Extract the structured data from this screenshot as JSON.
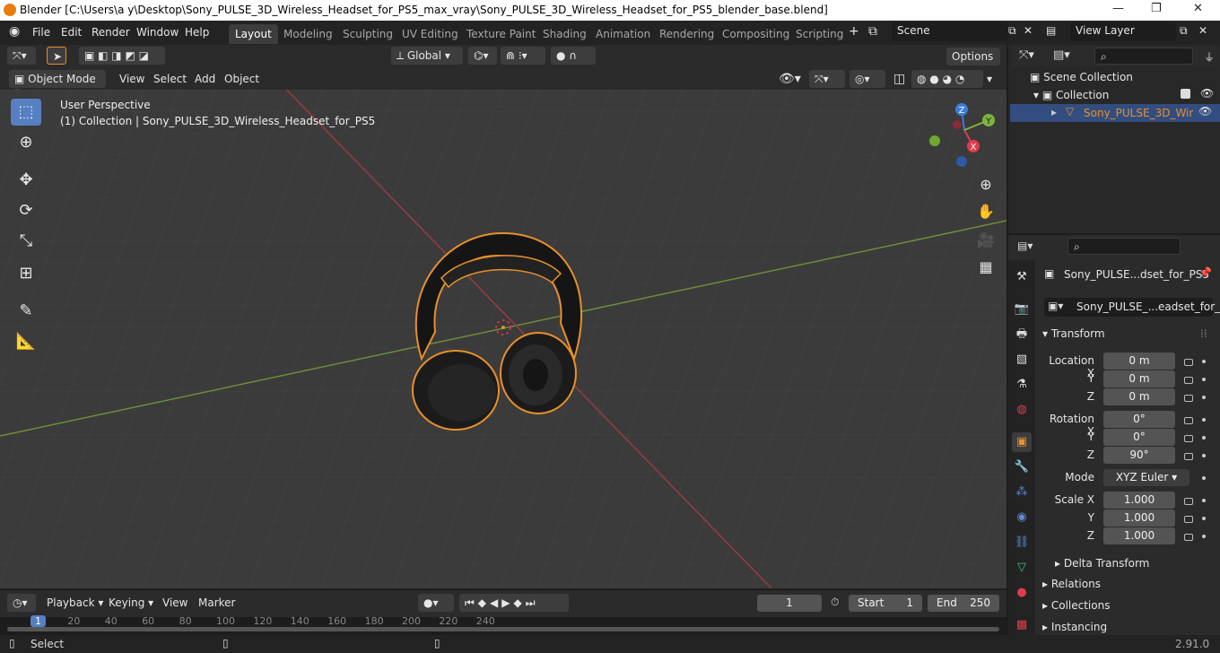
{
  "window": {
    "title": "Blender [C:\\Users\\a y\\Desktop\\Sony_PULSE_3D_Wireless_Headset_for_PS5_max_vray\\Sony_PULSE_3D_Wireless_Headset_for_PS5_blender_base.blend]"
  },
  "menus": [
    "File",
    "Edit",
    "Render",
    "Window",
    "Help"
  ],
  "workspaces": [
    "Layout",
    "Modeling",
    "Sculpting",
    "UV Editing",
    "Texture Paint",
    "Shading",
    "Animation",
    "Rendering",
    "Compositing",
    "Scripting"
  ],
  "active_workspace": "Layout",
  "scene": "Scene",
  "view_layer": "View Layer",
  "viewport_header": {
    "orientation": "Global",
    "options": "Options",
    "mode": "Object Mode",
    "view": "View",
    "select": "Select",
    "add": "Add",
    "object": "Object"
  },
  "viewport": {
    "perspective": "User Perspective",
    "collection_info": "(1) Collection | Sony_PULSE_3D_Wireless_Headset_for_PS5",
    "gizmo": {
      "x": "X",
      "y": "Y",
      "z": "Z"
    }
  },
  "outliner": {
    "scene_collection": "Scene Collection",
    "collection": "Collection",
    "object": "Sony_PULSE_3D_Wir"
  },
  "properties": {
    "object_name": "Sony_PULSE...dset_for_PS5",
    "data_name": "Sony_PULSE_...eadset_for_PS5",
    "transform": "Transform",
    "location_label": "Location X",
    "rotation_label": "Rotation X",
    "scale_label": "Scale X",
    "y": "Y",
    "z": "Z",
    "loc": [
      "0 m",
      "0 m",
      "0 m"
    ],
    "rot": [
      "0°",
      "0°",
      "90°"
    ],
    "scale": [
      "1.000",
      "1.000",
      "1.000"
    ],
    "mode_label": "Mode",
    "mode_value": "XYZ Euler",
    "delta": "Delta Transform",
    "relations": "Relations",
    "collections": "Collections",
    "instancing": "Instancing"
  },
  "timeline": {
    "playback": "Playback",
    "keying": "Keying",
    "view": "View",
    "marker": "Marker",
    "current_frame": "1",
    "start_label": "Start",
    "start": "1",
    "end_label": "End",
    "end": "250",
    "ticks": [
      "1",
      "20",
      "40",
      "60",
      "80",
      "100",
      "120",
      "140",
      "160",
      "180",
      "200",
      "220",
      "240"
    ]
  },
  "status": {
    "select": "Select",
    "version": "2.91.0"
  },
  "colors": {
    "accent": "#5680c2",
    "selection": "#e8902a",
    "x_axis": "#e23a4d",
    "y_axis": "#7db43c",
    "z_axis": "#3b7de0"
  }
}
